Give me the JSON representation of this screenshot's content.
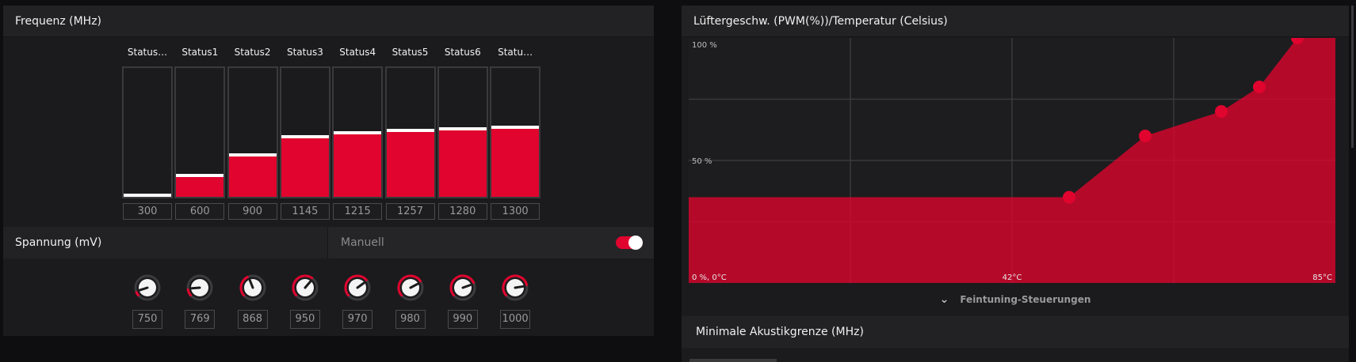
{
  "frequency": {
    "title": "Frequenz (MHz)",
    "states": [
      {
        "label": "Status…",
        "value": "300",
        "level": 0.02
      },
      {
        "label": "Status1",
        "value": "600",
        "level": 0.18
      },
      {
        "label": "Status2",
        "value": "900",
        "level": 0.34
      },
      {
        "label": "Status3",
        "value": "1145",
        "level": 0.48
      },
      {
        "label": "Status4",
        "value": "1215",
        "level": 0.51
      },
      {
        "label": "Status5",
        "value": "1257",
        "level": 0.53
      },
      {
        "label": "Status6",
        "value": "1280",
        "level": 0.54
      },
      {
        "label": "Statu…",
        "value": "1300",
        "level": 0.55
      }
    ]
  },
  "voltage": {
    "title": "Spannung (mV)",
    "manual_label": "Manuell",
    "manual_enabled": true,
    "states": [
      {
        "value": "750",
        "level": 0.1
      },
      {
        "value": "769",
        "level": 0.15
      },
      {
        "value": "868",
        "level": 0.42
      },
      {
        "value": "950",
        "level": 0.65
      },
      {
        "value": "970",
        "level": 0.7
      },
      {
        "value": "980",
        "level": 0.73
      },
      {
        "value": "990",
        "level": 0.76
      },
      {
        "value": "1000",
        "level": 0.8
      }
    ]
  },
  "fan": {
    "title": "Lüftergeschw. (PWM(%))/Temperatur (Celsius)",
    "finetune_label": "Feintuning-Steuerungen",
    "accent": "#e0042e"
  },
  "acoustic": {
    "title": "Minimale Akustikgrenze (MHz)"
  },
  "chart_data": {
    "type": "area",
    "title": "Lüftergeschw. (PWM(%))/Temperatur (Celsius)",
    "y_tick_labels": [
      "100 %",
      "50 %"
    ],
    "x_tick_labels": [
      "0 %, 0°C",
      "42°C",
      "85°C"
    ],
    "xlim": [
      0,
      85
    ],
    "ylim": [
      0,
      100
    ],
    "grid": true,
    "series": [
      {
        "x": [
          0,
          50,
          60,
          70,
          75,
          80,
          85
        ],
        "y": [
          35,
          35,
          60,
          70,
          80,
          100,
          100
        ],
        "points": [
          {
            "x": 50,
            "y": 35
          },
          {
            "x": 60,
            "y": 60
          },
          {
            "x": 70,
            "y": 70
          },
          {
            "x": 75,
            "y": 80
          },
          {
            "x": 80,
            "y": 100
          }
        ]
      }
    ]
  }
}
